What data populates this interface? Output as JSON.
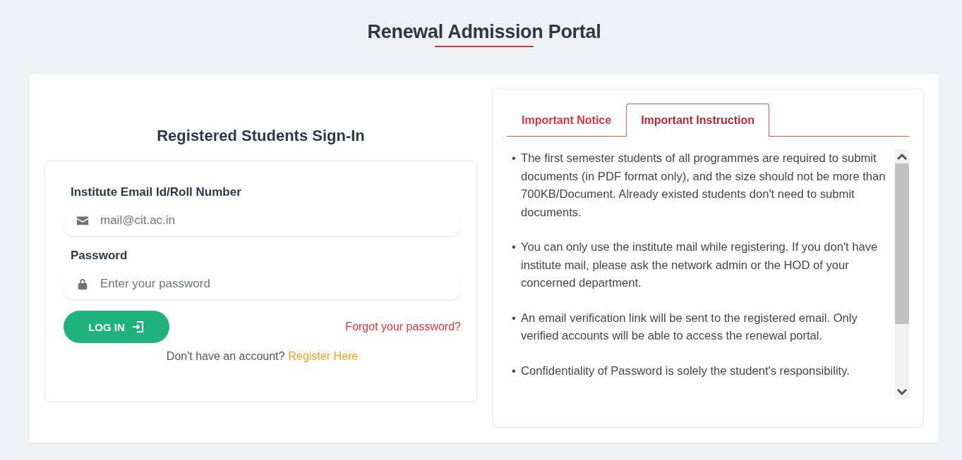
{
  "page_title": "Renewal Admission Portal",
  "sign_in": {
    "heading": "Registered Students Sign-In",
    "fields": [
      {
        "label": "Institute Email Id/Roll Number",
        "placeholder": "mail@cit.ac.in",
        "kind": "email"
      },
      {
        "label": "Password",
        "placeholder": "Enter your password",
        "kind": "password"
      }
    ],
    "login_button": "LOG IN",
    "forgot_link": "Forgot your password?",
    "register_prompt": "Don't have an account?",
    "register_link": "Register Here"
  },
  "info_panel": {
    "tabs": [
      {
        "label": "Important Notice",
        "selected": false
      },
      {
        "label": "Important Instruction",
        "selected": true
      }
    ],
    "bullet": "•",
    "instructions": [
      "The first semester students of all programmes are required to submit documents (in PDF format only), and the size should not be more than 700KB/Document. Already existed students don't need to submit documents.",
      "You can only use the institute mail while registering. If you don't have institute mail, please ask the network admin or the HOD of your concerned department.",
      "An email verification link will be sent to the registered email. Only verified accounts will be able to access the renewal portal.",
      "Confidentiality of Password is solely the student's responsibility."
    ]
  }
}
